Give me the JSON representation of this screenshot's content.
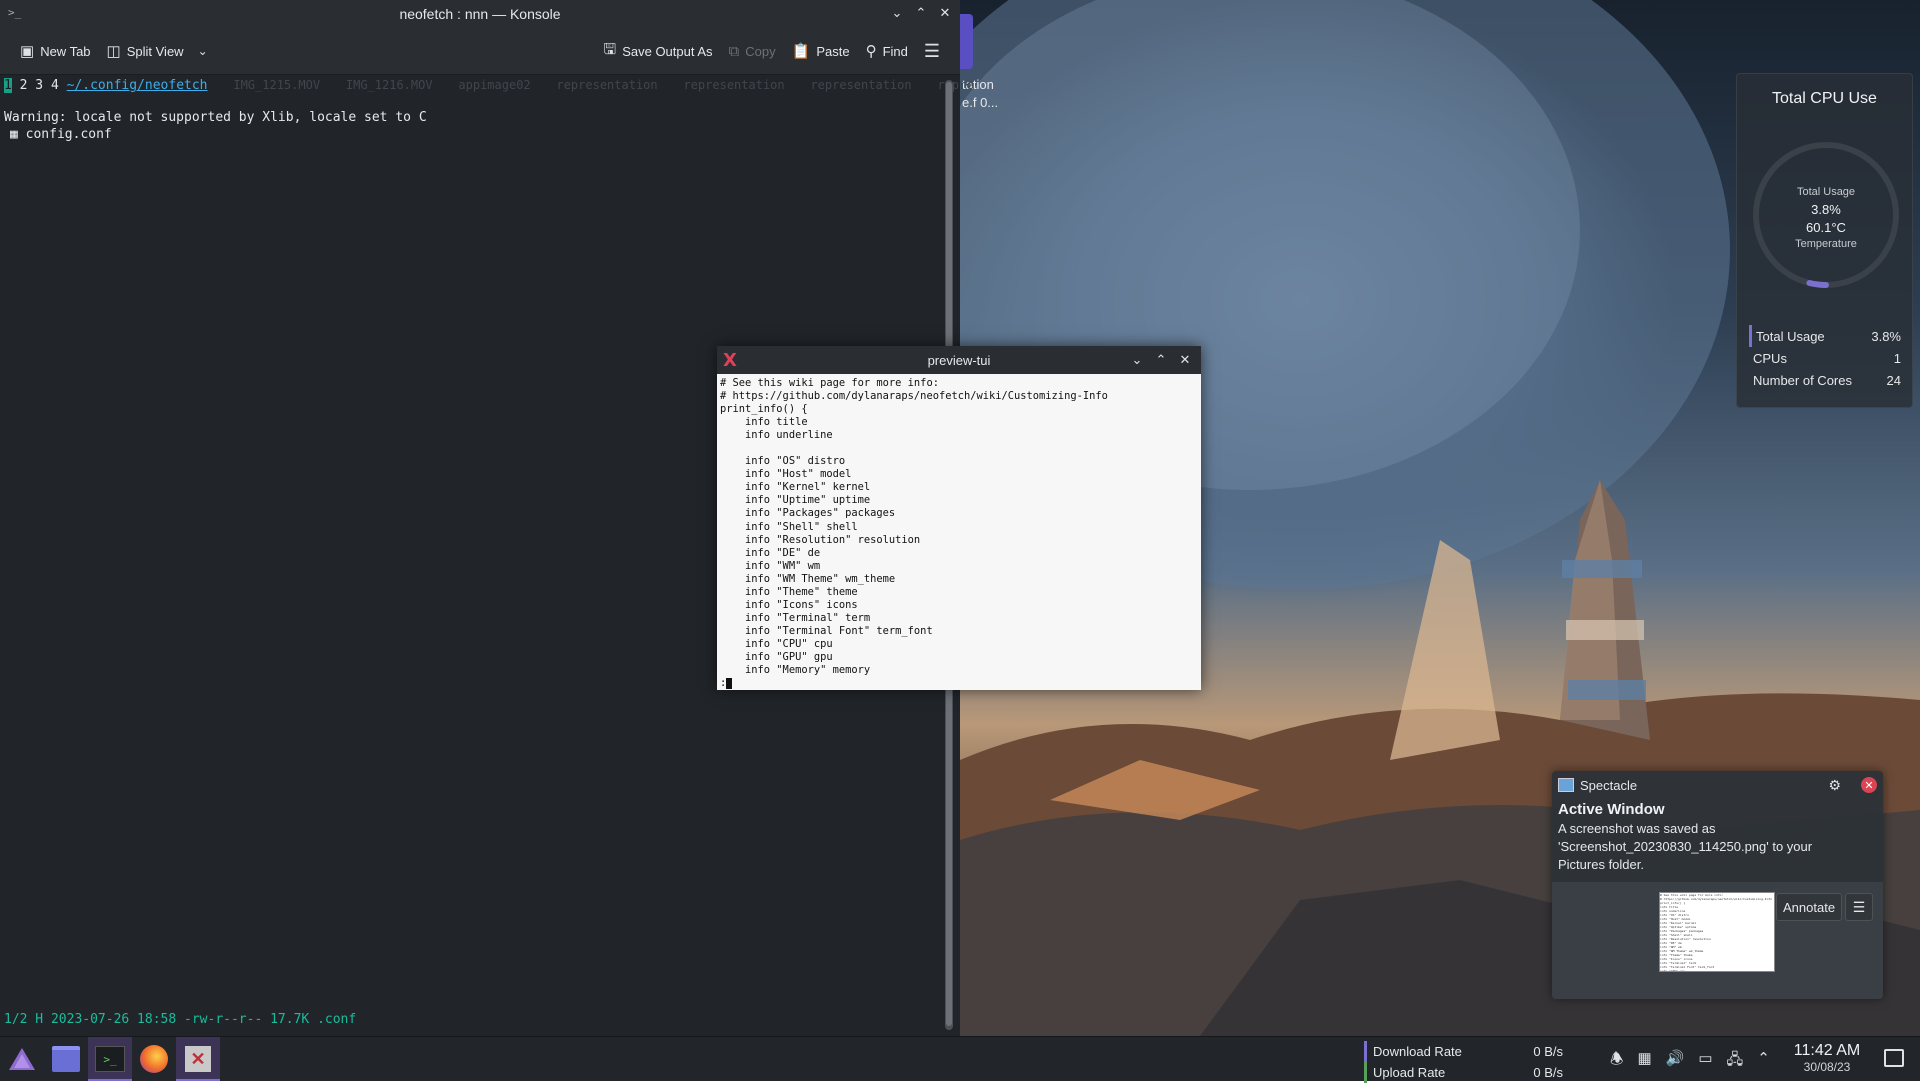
{
  "konsole": {
    "title": "neofetch : nnn — Konsole",
    "toolbar": {
      "new_tab": "New Tab",
      "split_view": "Split View",
      "save_output": "Save Output As",
      "copy": "Copy",
      "paste": "Paste",
      "find": "Find"
    },
    "terminal": {
      "tab_active": "1",
      "tabs_rest": " 2 3 4 ",
      "path": "~/.config/neofetch",
      "ghost_items": [
        "IMG_1215.MOV",
        "IMG_1216.MOV",
        "appimage02",
        "representation",
        "representation",
        "representation",
        "repre"
      ],
      "warning": "Warning: locale not supported by Xlib, locale set to C",
      "file_entry": "config.conf",
      "status": "1/2 H 2023-07-26 18:58 -rw-r--r-- 17.7K .conf"
    }
  },
  "overlap_text": [
    "tation",
    "e.f 0..."
  ],
  "preview": {
    "title": "preview-tui",
    "lines": [
      "# See this wiki page for more info:",
      "# https://github.com/dylanaraps/neofetch/wiki/Customizing-Info",
      "print_info() {",
      "    info title",
      "    info underline",
      "",
      "    info \"OS\" distro",
      "    info \"Host\" model",
      "    info \"Kernel\" kernel",
      "    info \"Uptime\" uptime",
      "    info \"Packages\" packages",
      "    info \"Shell\" shell",
      "    info \"Resolution\" resolution",
      "    info \"DE\" de",
      "    info \"WM\" wm",
      "    info \"WM Theme\" wm_theme",
      "    info \"Theme\" theme",
      "    info \"Icons\" icons",
      "    info \"Terminal\" term",
      "    info \"Terminal Font\" term_font",
      "    info \"CPU\" cpu",
      "    info \"GPU\" gpu",
      "    info \"Memory\" memory",
      ":"
    ]
  },
  "cpu_widget": {
    "title": "Total CPU Use",
    "gauge_label_top": "Total Usage",
    "gauge_usage": "3.8%",
    "gauge_temp": "60.1°C",
    "gauge_label_bottom": "Temperature",
    "usage_fraction": 0.038,
    "stats": [
      {
        "label": "Total Usage",
        "value": "3.8%"
      },
      {
        "label": "CPUs",
        "value": "1"
      },
      {
        "label": "Number of Cores",
        "value": "24"
      }
    ]
  },
  "spectacle": {
    "app": "Spectacle",
    "title": "Active Window",
    "message": "A screenshot was saved as 'Screenshot_20230830_114250.png' to your Pictures folder.",
    "annotate": "Annotate"
  },
  "taskbar": {
    "network": [
      {
        "label": "Download Rate",
        "value": "0 B/s"
      },
      {
        "label": "Upload Rate",
        "value": "0 B/s"
      }
    ],
    "time": "11:42 AM",
    "date": "30/08/23"
  },
  "colors": {
    "accent": "#7b6fd0",
    "terminal_bg": "#21252a",
    "path": "#3daee9",
    "status": "#1abc9c",
    "close_red": "#da4453"
  }
}
